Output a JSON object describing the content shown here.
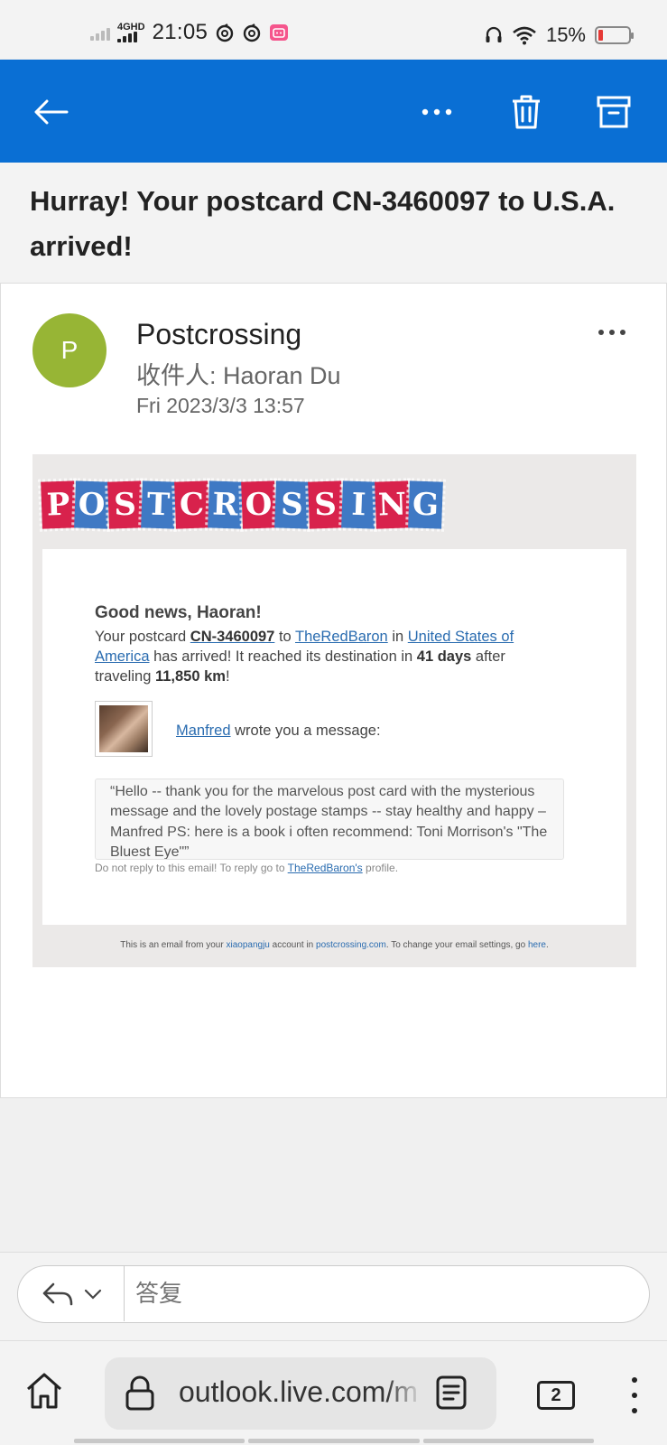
{
  "status_bar": {
    "network": "4GHD",
    "time": "21:05",
    "battery": "15%",
    "battery_level": 0.15
  },
  "app_bar": {
    "back": "back",
    "more": "more options",
    "delete": "delete",
    "archive": "archive"
  },
  "subject": "Hurray! Your postcard CN-3460097 to U.S.A. arrived!",
  "message": {
    "avatar_initial": "P",
    "sender": "Postcrossing",
    "recipient": "收件人: Haoran Du",
    "date": "Fri 2023/3/3 13:57"
  },
  "email": {
    "logo_letters": [
      "P",
      "O",
      "S",
      "T",
      "C",
      "R",
      "O",
      "S",
      "S",
      "I",
      "N",
      "G"
    ],
    "greeting": "Good news, Haoran!",
    "intro_before": "Your postcard ",
    "postcard_id": "CN-3460097",
    "to_text": " to ",
    "recipient_user": "TheRedBaron",
    "in_text": " in ",
    "country": "United States of America",
    "arrived_text": " has arrived! It reached its destination in ",
    "days": "41 days",
    "after_text": " after traveling ",
    "distance": "11,850 km",
    "end_text": "!",
    "writer": "Manfred",
    "wrote_text": " wrote you a message:",
    "quote": "“Hello -- thank you for the marvelous post card with the mysterious message and the lovely postage stamps -- stay healthy and happy – Manfred PS: here is a book i often recommend: Toni Morrison's \"The Bluest Eye\"”",
    "noreply_before": "Do not reply to this email! To reply go to ",
    "noreply_link": "TheRedBaron's",
    "noreply_after": " profile.",
    "footer_1": "This is an email from your ",
    "footer_account": "xiaopangju",
    "footer_2": " account in ",
    "footer_site": "postcrossing.com",
    "footer_3": ". To change your email settings, go ",
    "footer_here": "here",
    "footer_4": "."
  },
  "reply": {
    "placeholder": "答复"
  },
  "browser": {
    "url": "outlook.live.com/m",
    "tab_count": "2"
  }
}
